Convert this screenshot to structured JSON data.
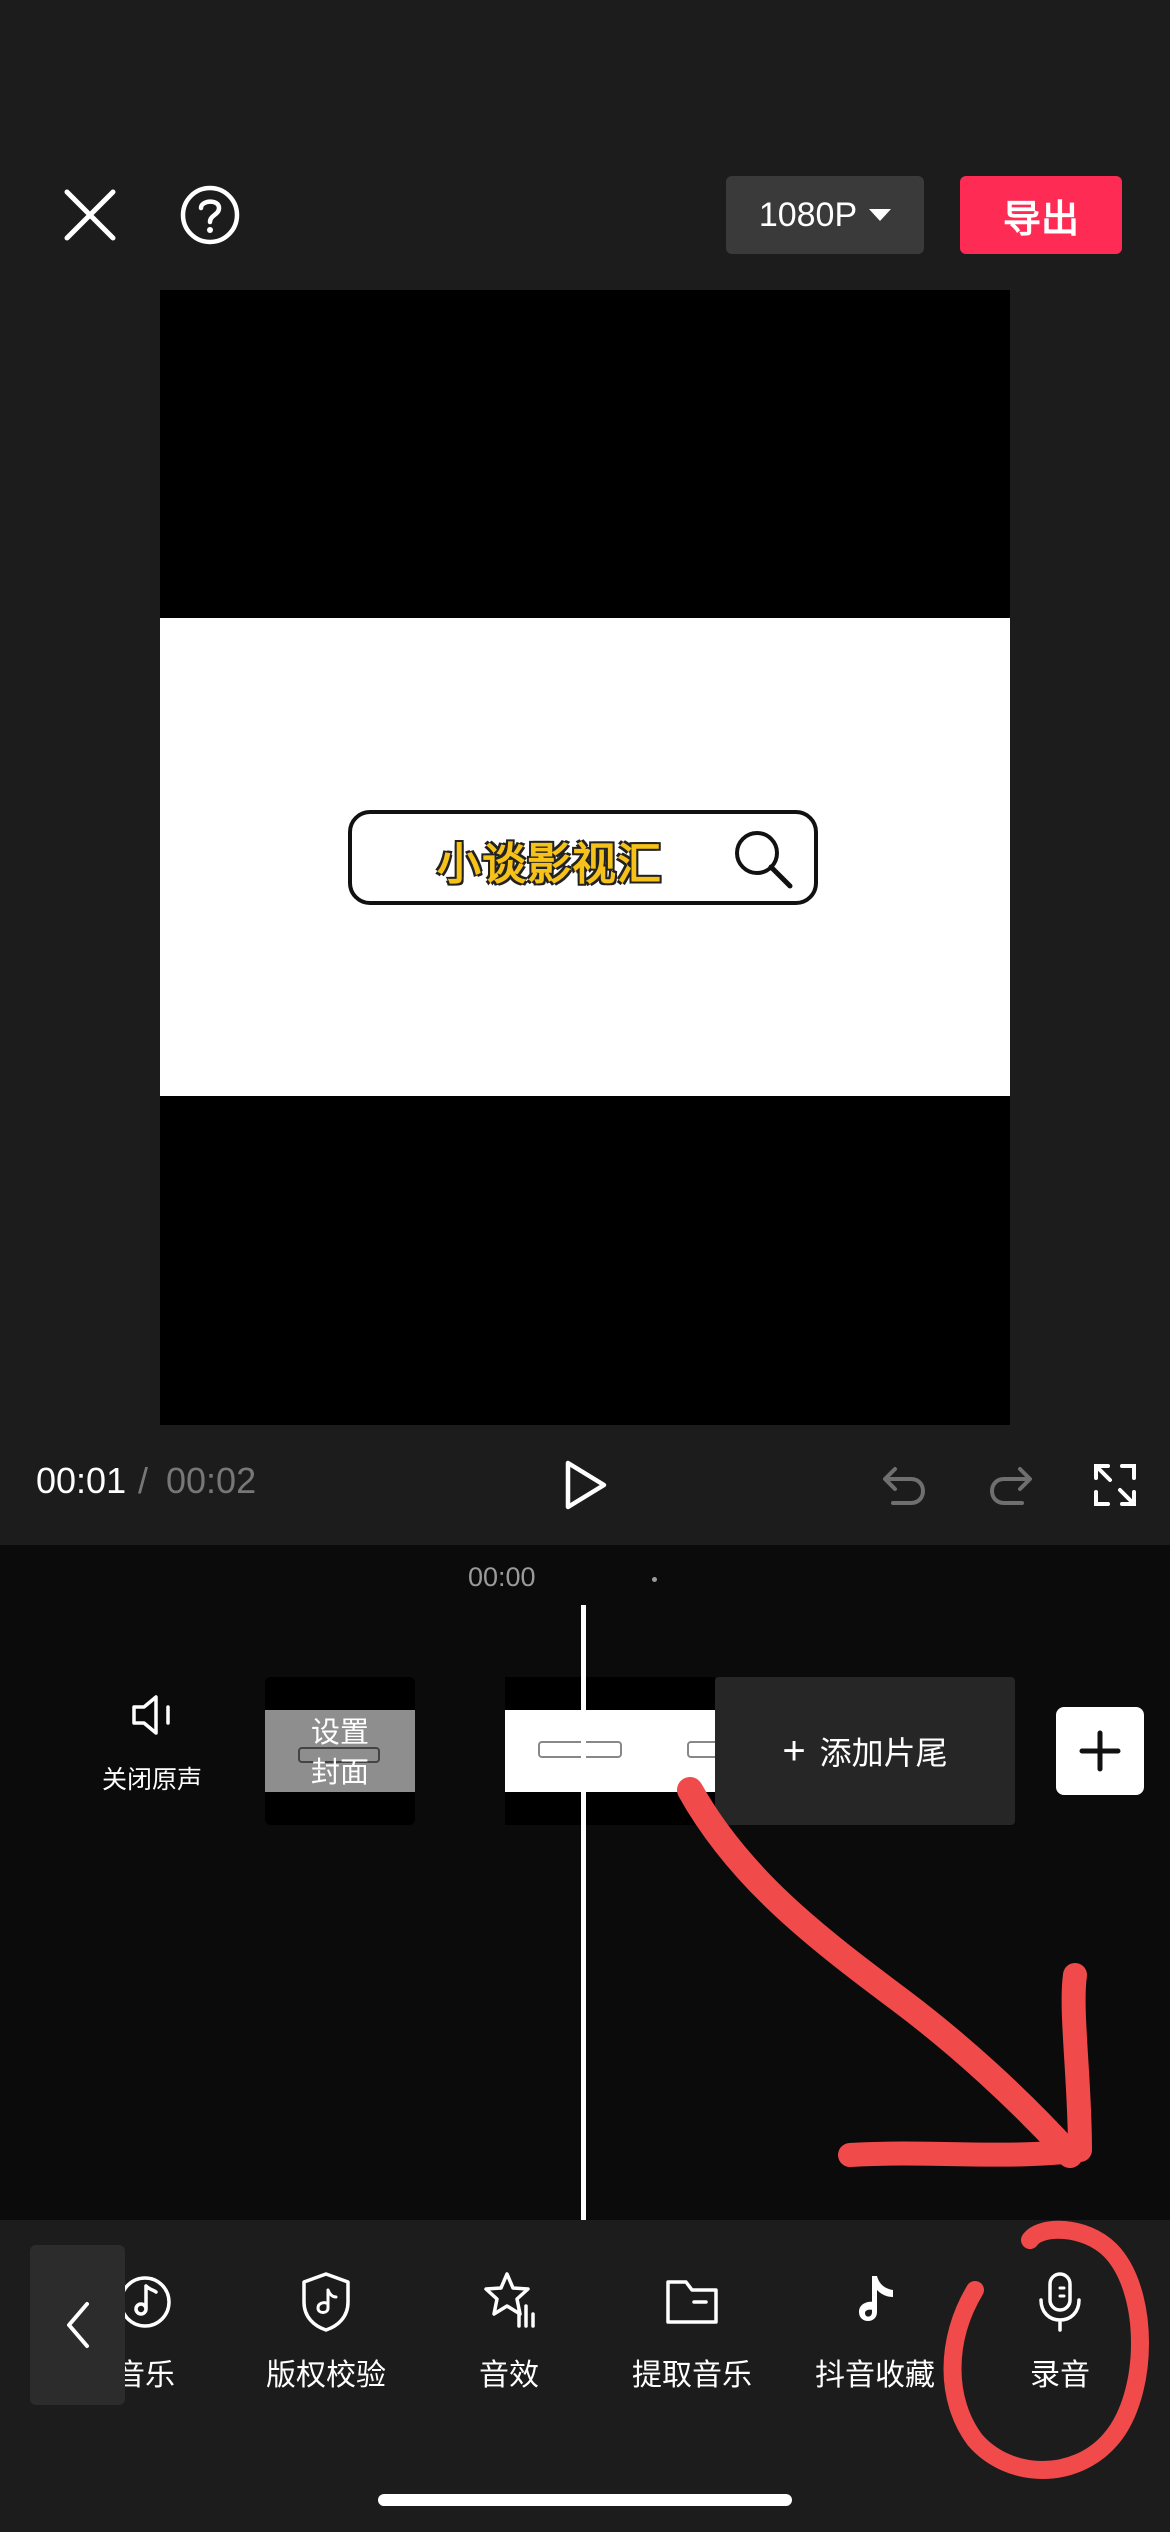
{
  "header": {
    "resolution_label": "1080P",
    "export_label": "导出"
  },
  "preview": {
    "search_text": "小谈影视汇"
  },
  "playback": {
    "current_time": "00:01",
    "separator": "/",
    "total_time": "00:02"
  },
  "timeline": {
    "ruler_time": "00:00",
    "mute_label": "关闭原声",
    "cover_label_line1": "设置",
    "cover_label_line2": "封面",
    "add_end_label": "添加片尾"
  },
  "toolbar": {
    "items": [
      {
        "label": "音乐",
        "icon": "music-note-icon"
      },
      {
        "label": "版权校验",
        "icon": "shield-tiktok-icon"
      },
      {
        "label": "音效",
        "icon": "star-sound-icon"
      },
      {
        "label": "提取音乐",
        "icon": "folder-icon"
      },
      {
        "label": "抖音收藏",
        "icon": "tiktok-icon"
      },
      {
        "label": "录音",
        "icon": "microphone-icon"
      }
    ]
  },
  "colors": {
    "background": "#1c1c1c",
    "timeline_bg": "#0b0b0b",
    "export_accent": "#fe2c55",
    "annotation": "#f04a4a",
    "search_text": "#f6c21a"
  }
}
